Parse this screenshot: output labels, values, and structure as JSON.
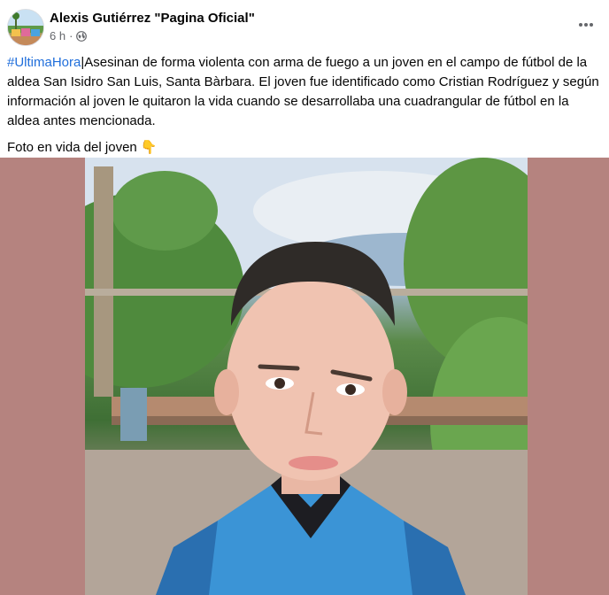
{
  "header": {
    "author": "Alexis Gutiérrez \"Pagina Oficial\"",
    "time": "6 h",
    "separator": "·",
    "avatar_icon": "profile-avatar",
    "privacy_icon": "globe-icon",
    "more_icon": "more-options-icon"
  },
  "post": {
    "hashtag": "#UltimaHora",
    "body": "|Asesinan de forma violenta con arma de fuego a un joven en el campo de fútbol de la aldea San Isidro San Luis, Santa Bàrbara. El joven fue identificado como Cristian Rodríguez y según información al joven le quitaron la vida cuando se desarrollaba una cuadrangular de fútbol en la aldea antes mencionada.",
    "caption": "Foto en vida del joven 👇"
  },
  "colors": {
    "hashtag": "#216fdb",
    "photo_background": "#b5837f",
    "meta_text": "#65676b"
  }
}
